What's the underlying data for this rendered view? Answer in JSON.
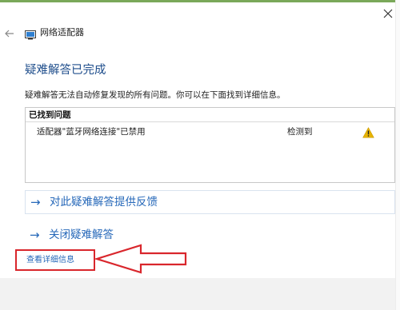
{
  "window": {
    "title": "网络适配器",
    "close_icon": "close-icon",
    "back_icon": "back-arrow-icon",
    "app_icon": "network-adapter-icon"
  },
  "main": {
    "heading": "疑难解答已完成",
    "description": "疑难解答无法自动修复发现的所有问题。你可以在下面找到详细信息。",
    "problems": {
      "header": "已找到问题",
      "items": [
        {
          "text": "适配器\"蓝牙网络连接\"已禁用",
          "status": "检测到",
          "icon": "warning-icon",
          "icon_color": "#e8b400"
        }
      ]
    },
    "links": {
      "feedback_arrow": "→",
      "feedback": "对此疑难解答提供反馈",
      "close_arrow": "→",
      "close": "关闭疑难解答",
      "details": "查看详细信息"
    }
  },
  "colors": {
    "accent": "#2668b9",
    "heading": "#1f4e8c",
    "annotation_red": "#d9262c"
  }
}
